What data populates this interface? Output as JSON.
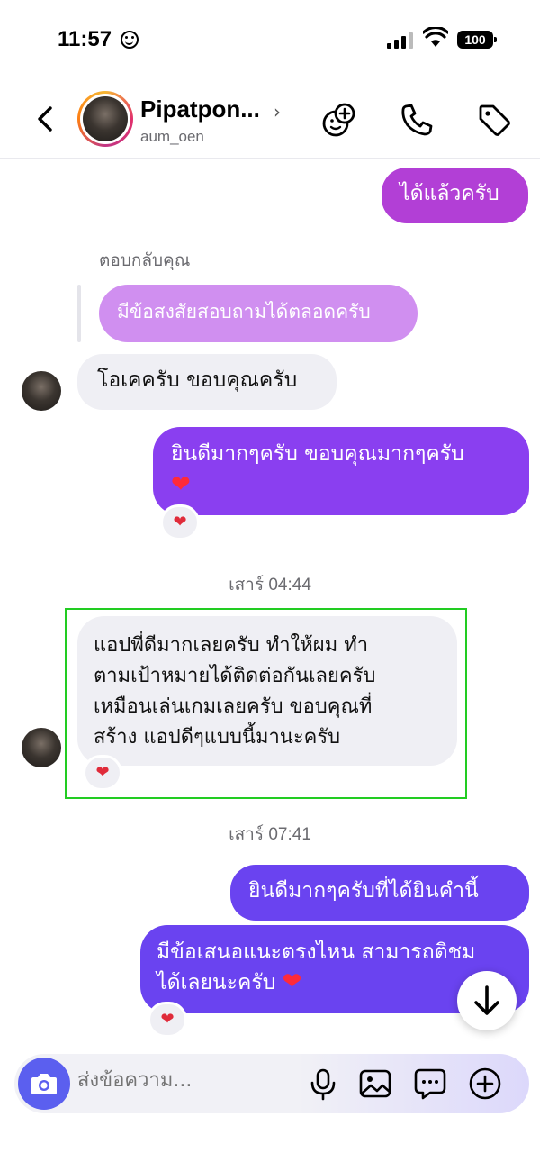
{
  "status_bar": {
    "time": "11:57",
    "battery": "100"
  },
  "header": {
    "contact_name": "Pipatpon...",
    "username": "aum_oen"
  },
  "messages": {
    "m1": "ได้แล้วครับ",
    "reply_label": "ตอบกลับคุณ",
    "reply_quote": "มีข้อสงสัยสอบถามได้ตลอดครับ",
    "m2": "โอเคครับ ขอบคุณครับ",
    "m3_line1": "ยินดีมากๆครับ ขอบคุณมากๆครับ",
    "timestamp1": "เสาร์ 04:44",
    "m4_line1": "แอปพี่ดีมากเลยครับ ทำให้ผม ทำ",
    "m4_line2": "ตามเป้าหมายได้ติดต่อกันเลยครับ",
    "m4_line3": "เหมือนเล่นเกมเลยครับ ขอบคุณที่",
    "m4_line4": "สร้าง แอปดีๆแบบนี้มานะครับ",
    "timestamp2": "เสาร์ 07:41",
    "m5": "ยินดีมากๆครับที่ได้ยินคำนี้",
    "m6_line1": "มีข้อเสนอแนะตรงไหน สามารถติชม",
    "m6_line2": "ได้เลยนะครับ"
  },
  "composer": {
    "placeholder": "ส่งข้อความ..."
  },
  "colors": {
    "bubble_magenta": "#b23fd6",
    "bubble_purple": "#8a3ff0",
    "bubble_indigo": "#6a43f0",
    "quote_bubble": "#d08ff0",
    "heart": "#e02b3a",
    "highlight": "#22cc22",
    "camera": "#5b5fef"
  },
  "icons": {
    "header": [
      "back-chevron-icon",
      "avatar-ring",
      "add-emoji-icon",
      "phone-icon",
      "tag-icon"
    ],
    "composer": [
      "camera-icon",
      "microphone-icon",
      "gallery-icon",
      "sticker-chat-icon",
      "plus-circle-icon"
    ]
  }
}
